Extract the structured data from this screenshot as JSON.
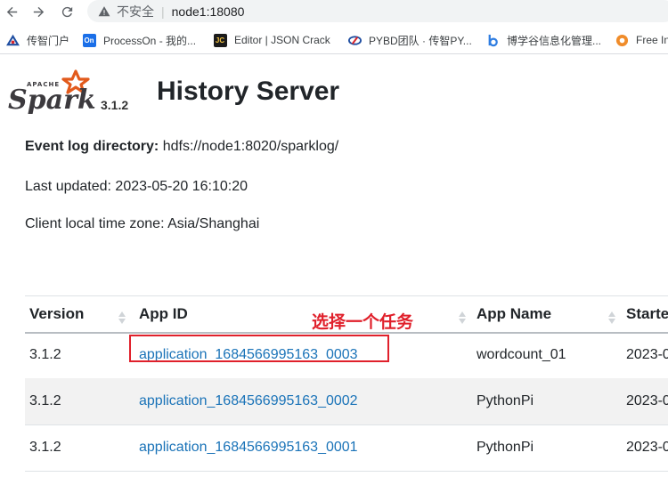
{
  "browser": {
    "url_host": "node1:18080",
    "security_label": "不安全",
    "bookmarks": [
      {
        "label": "传智门户",
        "icon": "chuanzhi-icon"
      },
      {
        "label": "ProcessOn - 我的...",
        "icon": "processon-icon"
      },
      {
        "label": "Editor | JSON Crack",
        "icon": "jsoncrack-icon"
      },
      {
        "label": "PYBD团队 · 传智PY...",
        "icon": "pybd-icon"
      },
      {
        "label": "博学谷信息化管理...",
        "icon": "boxuegu-icon"
      },
      {
        "label": "Free In",
        "icon": "free-icon"
      }
    ]
  },
  "header": {
    "logo_alt": "Apache Spark",
    "version": "3.1.2",
    "title": "History Server"
  },
  "info": {
    "event_log_label": "Event log directory:",
    "event_log_value": "hdfs://node1:8020/sparklog/",
    "last_updated": "Last updated: 2023-05-20 16:10:20",
    "time_zone": "Client local time zone: Asia/Shanghai"
  },
  "table": {
    "columns": [
      "Version",
      "App ID",
      "App Name",
      "Starte"
    ],
    "rows": [
      {
        "version": "3.1.2",
        "app_id": "application_1684566995163_0003",
        "app_name": "wordcount_01",
        "started": "2023-0"
      },
      {
        "version": "3.1.2",
        "app_id": "application_1684566995163_0002",
        "app_name": "PythonPi",
        "started": "2023-0"
      },
      {
        "version": "3.1.2",
        "app_id": "application_1684566995163_0001",
        "app_name": "PythonPi",
        "started": "2023-0"
      }
    ]
  },
  "annotation": {
    "text": "选择一个任务",
    "color": "#e0202b"
  },
  "colors": {
    "link": "#1a73b8",
    "spark_orange": "#e25a1c"
  }
}
